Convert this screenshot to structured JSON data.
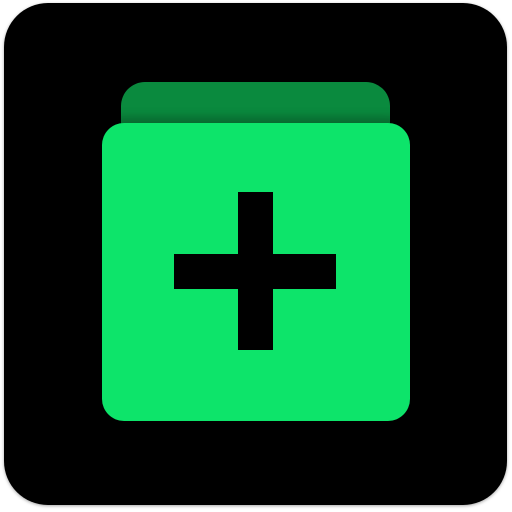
{
  "icon": {
    "name": "add-stack-app-icon",
    "symbol": "plus-icon",
    "colors": {
      "background": "#000000",
      "front_card": "#0de46a",
      "back_card": "#0a8a3e",
      "symbol": "#000000"
    }
  }
}
